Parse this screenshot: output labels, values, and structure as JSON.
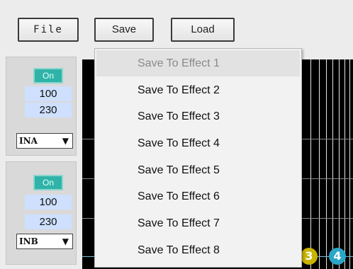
{
  "toolbar": {
    "file_label": "File",
    "save_label": "Save",
    "load_label": "Load"
  },
  "channels": [
    {
      "on_label": "On",
      "value1": "100",
      "value2": "230",
      "input": "INA"
    },
    {
      "on_label": "On",
      "value1": "100",
      "value2": "230",
      "input": "INB"
    }
  ],
  "save_menu": {
    "items": [
      {
        "label": "Save To Effect 1",
        "enabled": false
      },
      {
        "label": "Save To Effect 2",
        "enabled": true
      },
      {
        "label": "Save To Effect 3",
        "enabled": true
      },
      {
        "label": "Save To Effect 4",
        "enabled": true
      },
      {
        "label": "Save To Effect 5",
        "enabled": true
      },
      {
        "label": "Save To Effect 6",
        "enabled": true
      },
      {
        "label": "Save To Effect 7",
        "enabled": true
      },
      {
        "label": "Save To Effect 8",
        "enabled": true
      }
    ]
  },
  "graph": {
    "markers": [
      {
        "label": "3",
        "color": "#c8b400"
      },
      {
        "label": "4",
        "color": "#2aa6c8"
      }
    ]
  },
  "colors": {
    "on_button": "#2fb3a8",
    "value_box": "#cfe0ff",
    "graph_bg": "#000000"
  }
}
